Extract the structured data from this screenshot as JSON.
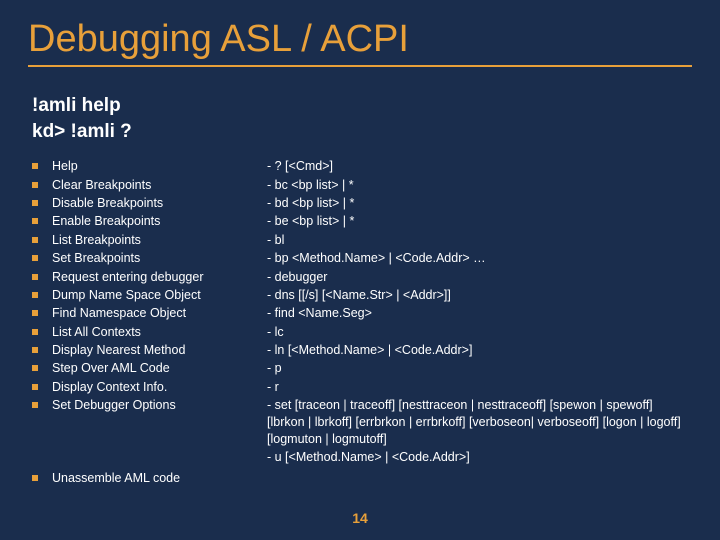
{
  "title": "Debugging ASL / ACPI",
  "subhead_line1": "!amli help",
  "subhead_line2": "kd> !amli ?",
  "commands": [
    {
      "name": "Help",
      "syntax": "- ? [<Cmd>]"
    },
    {
      "name": "Clear Breakpoints",
      "syntax": "- bc <bp list> | *"
    },
    {
      "name": "Disable Breakpoints",
      "syntax": "- bd <bp list> | *"
    },
    {
      "name": "Enable Breakpoints",
      "syntax": "- be <bp list> | *"
    },
    {
      "name": "List Breakpoints",
      "syntax": "- bl"
    },
    {
      "name": "Set Breakpoints",
      "syntax": "- bp <Method.Name> | <Code.Addr> …"
    },
    {
      "name": "Request entering debugger",
      "syntax": "- debugger"
    },
    {
      "name": "Dump Name Space Object",
      "syntax": "- dns [[/s] [<Name.Str> | <Addr>]]"
    },
    {
      "name": "Find Namespace Object",
      "syntax": "- find <Name.Seg>"
    },
    {
      "name": "List All Contexts",
      "syntax": "- lc"
    },
    {
      "name": "Display Nearest Method",
      "syntax": "- ln [<Method.Name> | <Code.Addr>]"
    },
    {
      "name": "Step Over AML Code",
      "syntax": "- p"
    },
    {
      "name": "Display Context Info.",
      "syntax": "- r"
    },
    {
      "name": "Set Debugger Options",
      "syntax": "- set [traceon | traceoff] [nesttraceon | nesttraceoff] [spewon | spewoff] [lbrkon | lbrkoff] [errbrkon | errbrkoff] [verboseon| verboseoff] [logon | logoff] [logmuton | logmutoff]"
    }
  ],
  "last_command": {
    "name": "Unassemble AML code",
    "syntax": "- u [<Method.Name> | <Code.Addr>]"
  },
  "page_number": "14"
}
